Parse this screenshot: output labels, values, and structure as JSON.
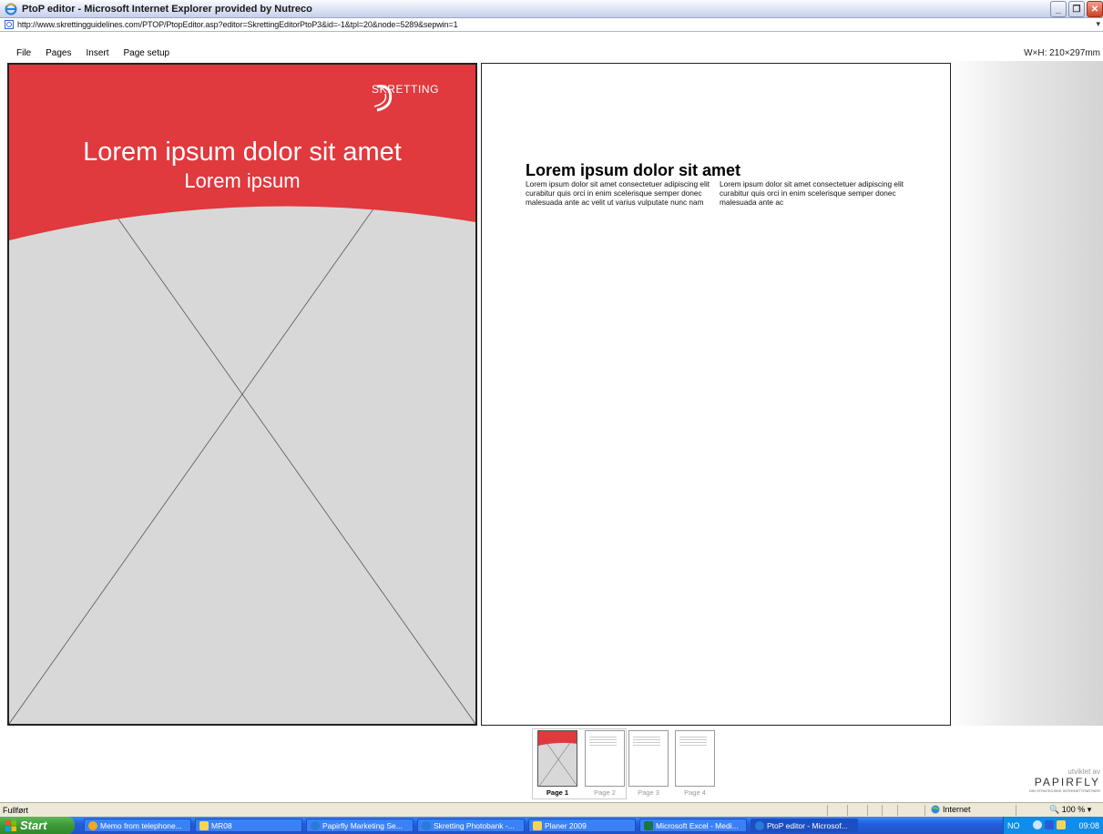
{
  "window": {
    "title": "PtoP editor - Microsoft Internet Explorer provided by Nutreco",
    "url": "http://www.skrettingguidelines.com/PTOP/PtopEditor.asp?editor=SkrettingEditorPtoP3&id=-1&tpl=20&node=5289&sepwin=1"
  },
  "menu": [
    "File",
    "Pages",
    "Insert",
    "Page setup"
  ],
  "page_size": "W×H: 210×297mm",
  "cover": {
    "logo": "SKRETTING",
    "title": "Lorem ipsum dolor sit amet",
    "subtitle": "Lorem ipsum",
    "accent": "#e0393e",
    "placeholder_bg": "#d8d8d8"
  },
  "document": {
    "heading": "Lorem ipsum dolor sit amet",
    "col1": "Lorem ipsum dolor sit amet consectetuer adipiscing elit curabitur quis orci in enim scelerisque semper donec malesuada ante ac velit ut varius vulputate nunc nam",
    "col2": "Lorem ipsum dolor sit amet consectetuer adipiscing elit curabitur quis orci in enim scelerisque semper donec malesuada ante ac"
  },
  "thumbnails": [
    {
      "label": "Page 1",
      "active": true
    },
    {
      "label": "Page 2",
      "active": false
    },
    {
      "label": "Page 3",
      "active": false
    },
    {
      "label": "Page 4",
      "active": false
    }
  ],
  "branding": {
    "developed_by": "utviklet av",
    "brand": "PAPIRFLY",
    "tagline": "DIN STRATEGISKE INTERNETTPARTNER"
  },
  "status": {
    "text": "Fullført",
    "zone": "Internet",
    "zoom": "100 %"
  },
  "taskbar": {
    "start": "Start",
    "tasks": [
      {
        "label": "Memo from telephone...",
        "icon": "orange-circle-icon"
      },
      {
        "label": "MR08",
        "icon": "folder-icon"
      },
      {
        "label": "Papirfly Marketing Se...",
        "icon": "ie-icon"
      },
      {
        "label": "Skretting Photobank -...",
        "icon": "ie-icon"
      },
      {
        "label": "Planer 2009",
        "icon": "folder-icon"
      },
      {
        "label": "Microsoft Excel - Medi...",
        "icon": "excel-icon"
      },
      {
        "label": "PtoP editor - Microsof...",
        "icon": "ie-icon",
        "active": true
      }
    ],
    "lang": "NO",
    "time": "09:08"
  }
}
